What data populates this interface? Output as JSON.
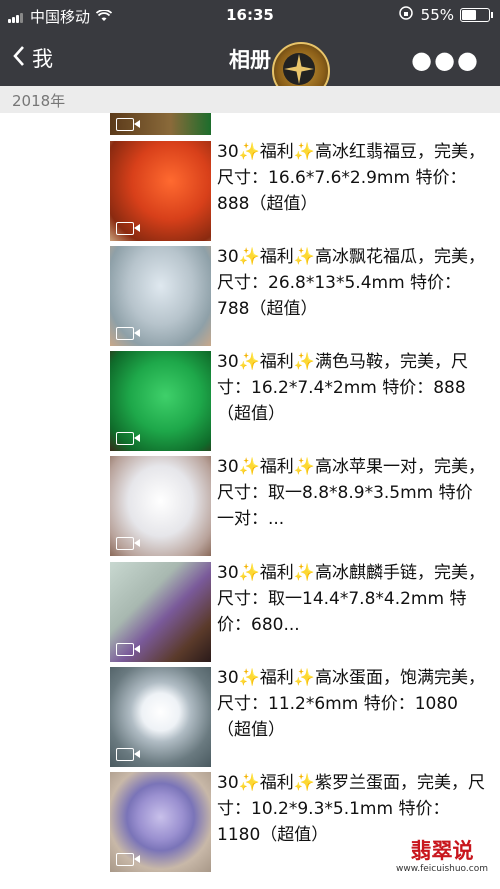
{
  "status": {
    "carrier": "中国移动",
    "time": "16:35",
    "battery": "55%"
  },
  "nav": {
    "back_label": "我",
    "title": "相册"
  },
  "section": {
    "year": "2018年"
  },
  "items": [
    {
      "text": "30✨福利✨高冰红翡福豆，完美，尺寸：16.6*7.6*2.9mm 特价：888（超值）"
    },
    {
      "text": "30✨福利✨高冰飘花福瓜，完美，尺寸：26.8*13*5.4mm 特价：788（超值）"
    },
    {
      "text": "30✨福利✨满色马鞍，完美，尺寸：16.2*7.4*2mm 特价：888（超值）"
    },
    {
      "text": "30✨福利✨高冰苹果一对，完美，尺寸：取一8.8*8.9*3.5mm 特价一对：..."
    },
    {
      "text": "30✨福利✨高冰麒麟手链，完美，尺寸：取一14.4*7.8*4.2mm 特价：680..."
    },
    {
      "text": "30✨福利✨高冰蛋面，饱满完美，尺寸：11.2*6mm 特价：1080（超值）"
    },
    {
      "text": "30✨福利✨紫罗兰蛋面，完美，尺寸：10.2*9.3*5.1mm 特价：1180（超值）"
    }
  ],
  "watermark": {
    "brand": "翡翠说",
    "url": "www.feicuishuo.com"
  },
  "colors": {
    "nav_bg": "#393a3f",
    "brand_red": "#c8161d"
  }
}
